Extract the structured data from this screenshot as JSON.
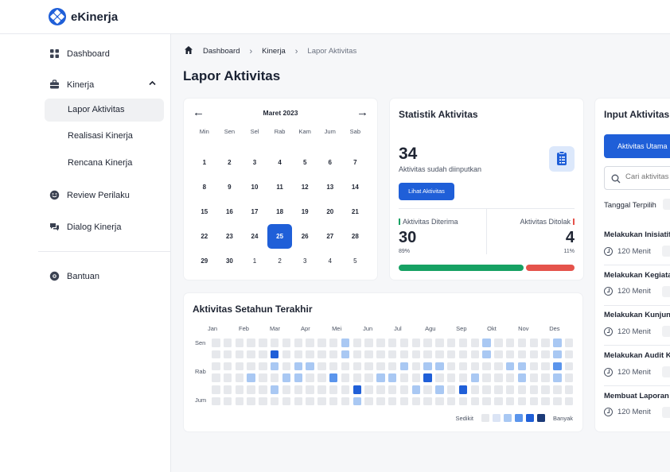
{
  "app": {
    "name": "eKinerja"
  },
  "sidebar": {
    "items": [
      {
        "label": "Dashboard",
        "icon": "grid-icon"
      },
      {
        "label": "Kinerja",
        "icon": "briefcase-icon"
      },
      {
        "label": "Review Perilaku",
        "icon": "smile-icon"
      },
      {
        "label": "Dialog Kinerja",
        "icon": "chat-icon"
      },
      {
        "label": "Bantuan",
        "icon": "help-icon"
      }
    ],
    "sub_items": [
      {
        "label": "Lapor Aktivitas",
        "active": true
      },
      {
        "label": "Realisasi Kinerja",
        "active": false
      },
      {
        "label": "Rencana Kinerja",
        "active": false
      }
    ]
  },
  "breadcrumb": [
    "Dashboard",
    "Kinerja",
    "Lapor Aktivitas"
  ],
  "page_title": "Lapor Aktivitas",
  "calendar": {
    "month": "Maret 2023",
    "prev_icon": "arrow-left-icon",
    "next_icon": "arrow-right-icon",
    "day_names": [
      "Min",
      "Sen",
      "Sel",
      "Rab",
      "Kam",
      "Jum",
      "Sab"
    ],
    "weeks": [
      [
        "",
        "",
        "",
        "",
        "",
        "",
        ""
      ],
      [
        "1",
        "2",
        "3",
        "4",
        "5",
        "6",
        "7"
      ],
      [
        "8",
        "9",
        "10",
        "11",
        "12",
        "13",
        "14"
      ],
      [
        "15",
        "16",
        "17",
        "18",
        "19",
        "20",
        "21"
      ],
      [
        "22",
        "23",
        "24",
        "25",
        "26",
        "27",
        "28"
      ],
      [
        "29",
        "30",
        "1",
        "2",
        "3",
        "4",
        "5"
      ]
    ],
    "selected": "25"
  },
  "stats": {
    "title": "Statistik Aktivitas",
    "total": "34",
    "total_label": "Aktivitas sudah diinputkan",
    "button_label": "Lihat Aktivitas",
    "accepted_label": "Aktivitas Diterima",
    "accepted": "30",
    "accepted_pct": "89%",
    "rejected_label": "Aktivitas Ditolak",
    "rejected": "4",
    "rejected_pct": "11%",
    "accepted_fraction": 0.72,
    "colors": {
      "accepted": "#16a163",
      "rejected": "#e5534b",
      "accent": "#1f5fd8"
    }
  },
  "heatmap": {
    "title": "Aktivitas Setahun Terakhir",
    "months": [
      "Jan",
      "Feb",
      "Mar",
      "Apr",
      "Mei",
      "Jun",
      "Jul",
      "Agu",
      "Sep",
      "Okt",
      "Nov",
      "Des"
    ],
    "row_labels": [
      "Sen",
      "Rab",
      "Jum"
    ],
    "legend_low": "Sedikit",
    "legend_high": "Banyak",
    "palette": [
      "#e6e8ec",
      "#dbe4f5",
      "#a9c8f3",
      "#5b95ec",
      "#1f5fd8",
      "#1b3a78"
    ],
    "levels": [
      [
        0,
        0,
        0,
        0,
        0,
        0,
        0,
        0,
        0,
        0,
        0,
        2,
        0,
        0,
        0,
        0,
        0,
        0,
        0,
        0,
        0,
        0,
        0,
        2,
        0,
        0,
        0,
        0,
        0,
        2,
        0
      ],
      [
        0,
        0,
        0,
        0,
        0,
        4,
        0,
        0,
        0,
        0,
        0,
        2,
        0,
        0,
        0,
        0,
        0,
        0,
        0,
        0,
        0,
        0,
        0,
        2,
        0,
        0,
        0,
        0,
        0,
        2,
        0
      ],
      [
        0,
        0,
        0,
        0,
        0,
        2,
        0,
        2,
        2,
        0,
        0,
        0,
        0,
        0,
        0,
        0,
        2,
        0,
        2,
        2,
        0,
        0,
        0,
        0,
        0,
        2,
        2,
        0,
        0,
        3,
        0
      ],
      [
        0,
        0,
        0,
        2,
        0,
        0,
        2,
        2,
        0,
        0,
        3,
        0,
        0,
        0,
        2,
        2,
        0,
        0,
        4,
        0,
        0,
        0,
        2,
        0,
        0,
        0,
        2,
        0,
        0,
        2,
        0
      ],
      [
        0,
        0,
        0,
        0,
        0,
        2,
        0,
        0,
        0,
        0,
        0,
        0,
        4,
        0,
        0,
        0,
        0,
        2,
        0,
        2,
        0,
        4,
        0,
        0,
        0,
        0,
        0,
        0,
        0,
        0,
        0
      ],
      [
        0,
        0,
        0,
        0,
        0,
        0,
        0,
        0,
        0,
        0,
        0,
        0,
        2,
        0,
        0,
        0,
        0,
        0,
        0,
        0,
        0,
        0,
        0,
        0,
        0,
        0,
        0,
        0,
        0,
        0,
        0
      ]
    ]
  },
  "input": {
    "title": "Input Aktivitas",
    "tab_label": "Aktivitas Utama",
    "search_placeholder": "Cari aktivitas",
    "date_label": "Tanggal Terpilih",
    "activities": [
      {
        "title": "Melakukan Inisiatif",
        "duration": "120 Menit"
      },
      {
        "title": "Melakukan Kegiatan",
        "duration": "120 Menit"
      },
      {
        "title": "Melakukan Kunjungan",
        "duration": "120 Menit"
      },
      {
        "title": "Melakukan Audit K",
        "duration": "120 Menit"
      },
      {
        "title": "Membuat Laporan",
        "duration": "120 Menit"
      }
    ]
  }
}
